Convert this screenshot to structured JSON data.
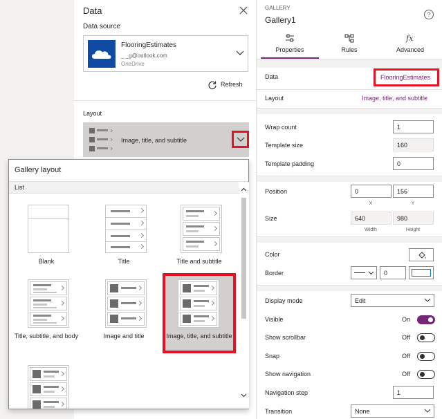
{
  "data_panel": {
    "title": "Data",
    "source_label": "Data source",
    "source": {
      "name": "FlooringEstimates",
      "email": "_ _g@outlook.com",
      "provider": "OneDrive"
    },
    "refresh_label": "Refresh",
    "layout_label": "Layout",
    "layout_value": "Image, title, and subtitle"
  },
  "gallery_layout": {
    "title": "Gallery layout",
    "section": "List",
    "items": [
      {
        "label": "Blank",
        "selected": false
      },
      {
        "label": "Title",
        "selected": false
      },
      {
        "label": "Title and subtitle",
        "selected": false
      },
      {
        "label": "Title, subtitle, and body",
        "selected": false
      },
      {
        "label": "Image and title",
        "selected": false
      },
      {
        "label": "Image, title, and subtitle",
        "selected": true
      }
    ]
  },
  "properties": {
    "category": "GALLERY",
    "name": "Gallery1",
    "help": "?",
    "tabs": [
      {
        "label": "Properties",
        "icon": "sliders-icon",
        "active": true
      },
      {
        "label": "Rules",
        "icon": "rules-icon",
        "active": false
      },
      {
        "label": "Advanced",
        "icon": "fx-icon",
        "active": false
      }
    ],
    "data_label": "Data",
    "data_value": "FlooringEstimates",
    "layout_label": "Layout",
    "layout_value": "Image, title, and subtitle",
    "wrap_count_label": "Wrap count",
    "wrap_count": "1",
    "template_size_label": "Template size",
    "template_size": "160",
    "template_padding_label": "Template padding",
    "template_padding": "0",
    "position_label": "Position",
    "x": "0",
    "y": "156",
    "x_label": "X",
    "y_label": "Y",
    "size_label": "Size",
    "width": "640",
    "height": "980",
    "width_label": "Width",
    "height_label": "Height",
    "color_label": "Color",
    "border_label": "Border",
    "border_width": "0",
    "display_mode_label": "Display mode",
    "display_mode": "Edit",
    "visible_label": "Visible",
    "visible_state": "On",
    "show_scrollbar_label": "Show scrollbar",
    "show_scrollbar_state": "Off",
    "snap_label": "Snap",
    "snap_state": "Off",
    "show_navigation_label": "Show navigation",
    "show_navigation_state": "Off",
    "navigation_step_label": "Navigation step",
    "navigation_step": "1",
    "transition_label": "Transition",
    "transition": "None"
  },
  "colors": {
    "accent": "#742774",
    "highlight": "#e81123",
    "onedrive": "#0f4ba3"
  }
}
